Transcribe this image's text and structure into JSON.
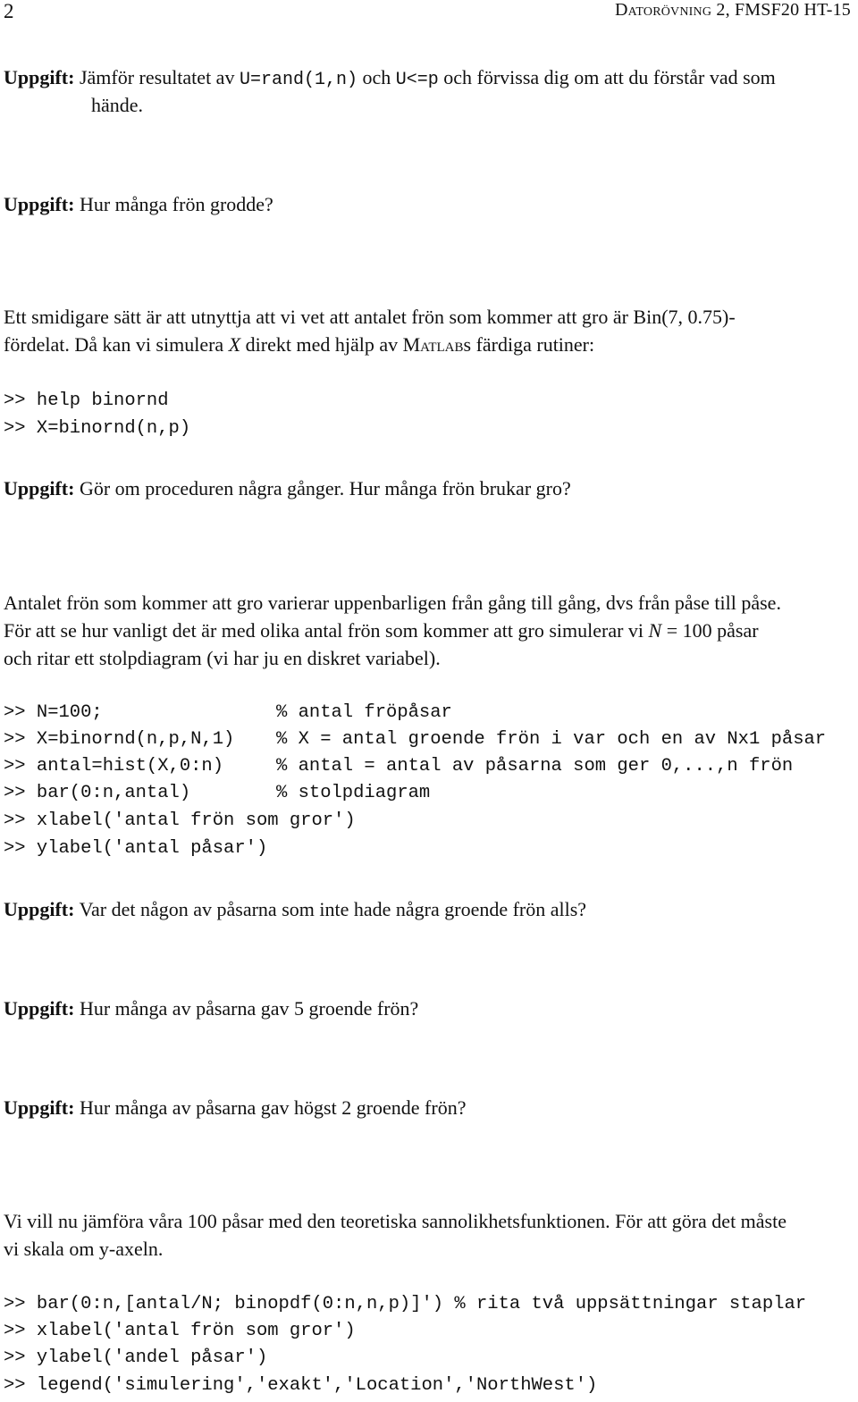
{
  "header": {
    "page_number": "2",
    "title": "Datorövning 2, FMSF20 HT-15"
  },
  "task_label": "Uppgift:",
  "tasks": {
    "t1": {
      "pre": "Jämför resultatet av ",
      "code1": "U=rand(1,n)",
      "mid": " och ",
      "code2": "U<=p",
      "post": " och förvissa dig om att du förstår vad som",
      "cont": "hände."
    },
    "t2": {
      "text": "Hur många frön grodde?"
    },
    "t3": {
      "text": "Gör om proceduren några gånger. Hur många frön brukar gro?"
    },
    "t4": {
      "text": "Var det någon av påsarna som inte hade några groende frön alls?"
    },
    "t5": {
      "text": "Hur många av påsarna gav 5 groende frön?"
    },
    "t6": {
      "text": "Hur många av påsarna gav högst 2 groende frön?"
    }
  },
  "para1": {
    "line1": "Ett smidigare sätt är att utnyttja att vi vet att antalet frön som kommer att gro är Bin(7, 0.75)-",
    "line2_pre": "fördelat. Då kan vi simulera ",
    "line2_var": "X",
    "line2_mid": " direkt med hjälp av ",
    "line2_matlab": "Matlab",
    "line2_post": "s färdiga rutiner:"
  },
  "code1": [
    ">> help binornd",
    ">> X=binornd(n,p)"
  ],
  "para2": {
    "line1": "Antalet frön som kommer att gro varierar uppenbarligen från gång till gång, dvs från påse till påse.",
    "line2_pre": "För att se hur vanligt det är med olika antal frön som kommer att gro simulerar vi ",
    "line2_var": "N",
    "line2_post": " = 100 påsar",
    "line3": "och ritar ett stolpdiagram (vi har ju en diskret variabel)."
  },
  "code2": [
    {
      "cmd": ">> N=100;",
      "comment": "% antal fröpåsar"
    },
    {
      "cmd": ">> X=binornd(n,p,N,1)",
      "comment": "% X = antal groende frön i var och en av Nx1 påsar"
    },
    {
      "cmd": ">> antal=hist(X,0:n)",
      "comment": "% antal = antal av påsarna som ger 0,...,n frön"
    },
    {
      "cmd": ">> bar(0:n,antal)",
      "comment": "% stolpdiagram"
    },
    {
      "cmd": ">> xlabel('antal frön som gror')",
      "comment": ""
    },
    {
      "cmd": ">> ylabel('antal påsar')",
      "comment": ""
    }
  ],
  "para3": {
    "line1": "Vi vill nu jämföra våra 100 påsar med den teoretiska sannolikhetsfunktionen. För att göra det måste",
    "line2": "vi skala om y-axeln."
  },
  "code3": [
    ">> bar(0:n,[antal/N; binopdf(0:n,n,p)]') % rita två uppsättningar staplar",
    ">> xlabel('antal frön som gror')",
    ">> ylabel('andel påsar')",
    ">> legend('simulering','exakt','Location','NorthWest')"
  ]
}
